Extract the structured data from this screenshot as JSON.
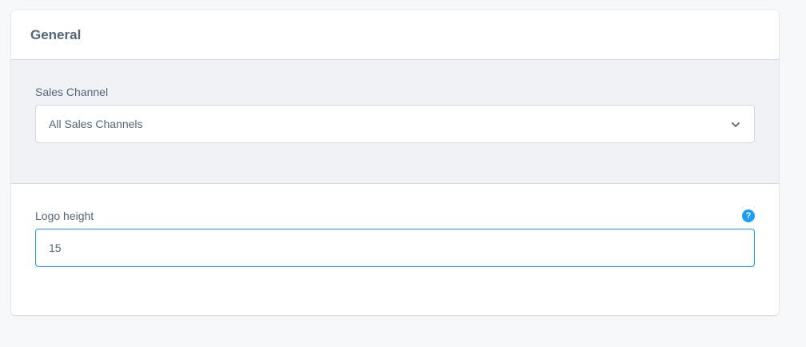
{
  "card": {
    "title": "General"
  },
  "sales_channel": {
    "label": "Sales Channel",
    "selected": "All Sales Channels"
  },
  "logo_height": {
    "label": "Logo height",
    "value": "15",
    "help_glyph": "?"
  },
  "icons": {
    "select_chevron": "chevron-down-icon",
    "help": "help-circle-icon"
  },
  "colors": {
    "accent": "#189eff",
    "text": "#52667a",
    "border": "#d1d9e0",
    "section_bg": "#f0f2f5",
    "page_bg": "#f7f8fa"
  }
}
